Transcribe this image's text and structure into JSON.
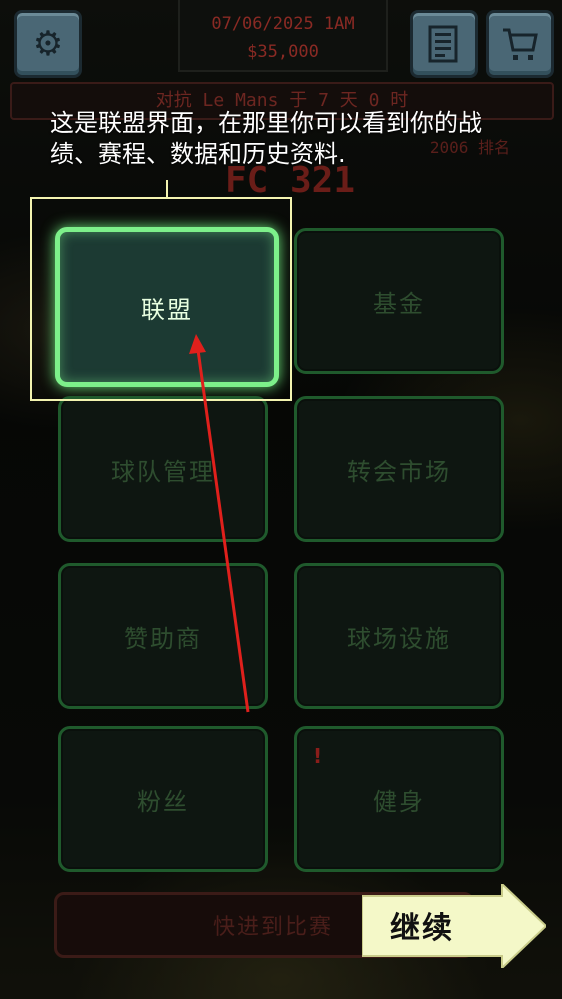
{
  "header": {
    "date": "07/06/2025 1AM",
    "money": "$35,000",
    "settings_icon": "gear-icon",
    "news_icon": "newspaper-icon",
    "shop_icon": "cart-icon"
  },
  "match": {
    "next_match": "对抗 Le Mans 于 7 天 0 时",
    "sub_info": "2006     排名",
    "score": "FC 321"
  },
  "tutorial": {
    "text": "这是联盟界面，在那里你可以看到你的战绩、赛程、数据和历史资料."
  },
  "menu": {
    "league": "联盟",
    "fund": "基金",
    "team_management": "球队管理",
    "transfer_market": "转会市场",
    "sponsors": "赞助商",
    "stadium": "球场设施",
    "fans": "粉丝",
    "fitness": "健身",
    "fitness_alert": "!"
  },
  "bottom": {
    "fast_forward": "快进到比赛",
    "continue": "继续"
  },
  "colors": {
    "active_border": "#7df08a",
    "inactive_border": "#1f5a2c",
    "highlight": "#f3f4b0",
    "arrow": "#e0201c",
    "continue_bg": "#f4f8c8"
  }
}
